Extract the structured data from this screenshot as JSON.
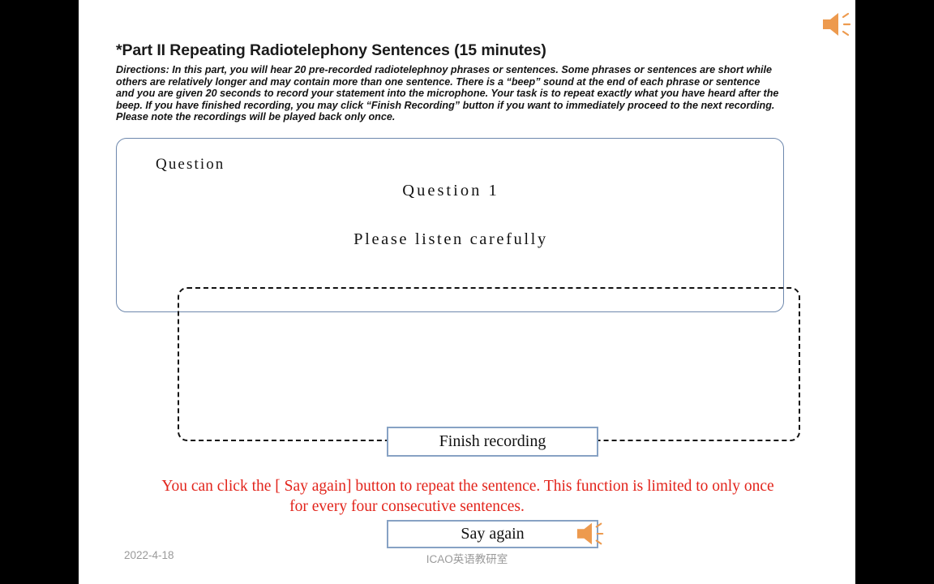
{
  "slide": {
    "title": "*Part II Repeating Radiotelephony Sentences (15 minutes)",
    "directions": "Directions: In this part, you will hear 20 pre-recorded radiotelephnoy phrases or sentences. Some phrases or sentences are short while others are relatively longer and may contain more than one sentence. There is a “beep” sound at the end of each phrase or sentence and you are given 20 seconds to record your statement into the microphone. Your task is to repeat exactly what you have heard after the beep. If you have finished recording, you may click “Finish Recording” button if you want to immediately proceed to the next recording. Please note the recordings will be played back only once."
  },
  "question_box": {
    "label": "Question",
    "number": "Question 1",
    "instruction": "Please listen carefully"
  },
  "controls": {
    "finish_recording_label": "Finish recording",
    "say_again_label": "Say again",
    "top_audio_icon": "speaker-icon",
    "button_audio_icon": "speaker-icon"
  },
  "notice": {
    "line1": "You can click the [ Say again] button to repeat the sentence. This function is limited to only once",
    "line2": "for every four consecutive sentences."
  },
  "footer": {
    "date": "2022-4-18",
    "organization": "ICAO英语教研室"
  },
  "colors": {
    "accent_orange": "#ED9A4E",
    "notice_red": "#E2241B",
    "box_blue": "#6E88AD",
    "button_border": "#87A2C4",
    "footer_gray": "#9A9A9A"
  }
}
